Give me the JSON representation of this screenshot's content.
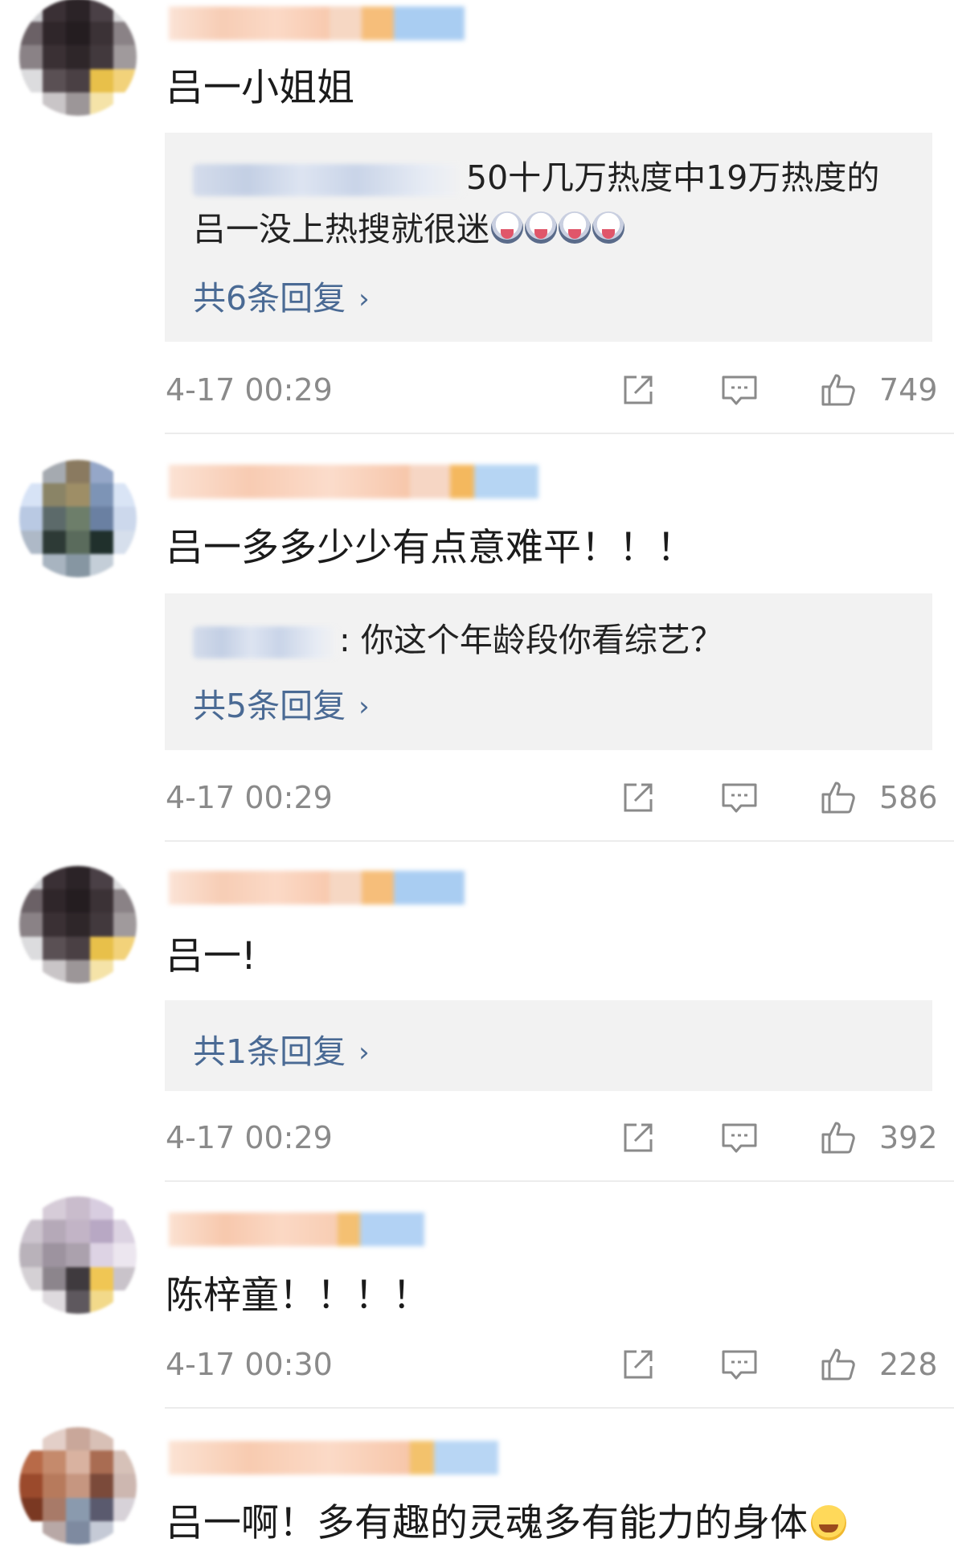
{
  "comments": [
    {
      "text": "吕一小姐姐",
      "reply_preview": [
        "50十几万热度中19万热度的",
        "吕一没上热搜就很迷"
      ],
      "reply_emoji_count": 4,
      "more_replies": "共6条回复",
      "time": "4-17 00:29",
      "likes": "749"
    },
    {
      "text": "吕一多多少少有点意难平！！！",
      "reply_preview": [
        ": 你这个年龄段你看综艺？"
      ],
      "more_replies": "共5条回复",
      "time": "4-17 00:29",
      "likes": "586"
    },
    {
      "text": "吕一!",
      "more_replies": "共1条回复",
      "time": "4-17 00:29",
      "likes": "392"
    },
    {
      "text": "陈梓童！！！！",
      "time": "4-17 00:30",
      "likes": "228"
    },
    {
      "text": "吕一啊！多有趣的灵魂多有能力的身体",
      "emoji": "laughing-crying"
    }
  ],
  "icons": {
    "share": "share-icon",
    "comment": "comment-icon",
    "like": "thumbs-up-icon",
    "chevron": "›"
  },
  "colors": {
    "link": "#4a6a94",
    "meta": "#8a8a8a",
    "reply_bg": "#f2f2f2"
  }
}
